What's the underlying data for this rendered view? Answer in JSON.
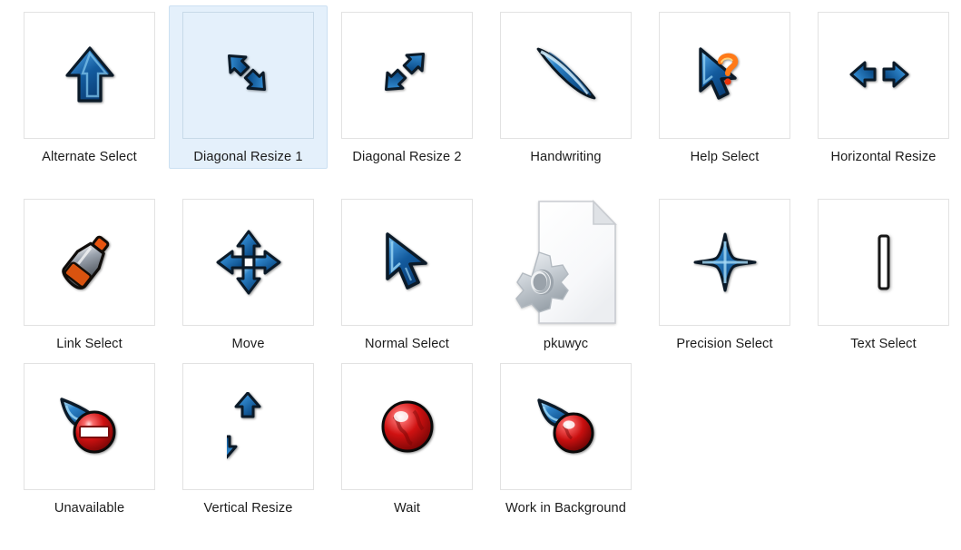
{
  "view": {
    "kind": "file-explorer-icon-grid",
    "columns": 6,
    "rows": 3,
    "background": "#ffffff",
    "selection_background": "#e4f0fb",
    "selection_border": "#cce0f2",
    "thumb_border": "#e2e2e2",
    "label_color": "#1b1b1b"
  },
  "items": [
    {
      "label": "Alternate Select",
      "icon": "cursor-arrow-up",
      "selected": false,
      "framed": true,
      "row": 1,
      "col": 1
    },
    {
      "label": "Diagonal Resize 1",
      "icon": "cursor-resize-diagonal-1",
      "selected": true,
      "framed": true,
      "row": 1,
      "col": 2
    },
    {
      "label": "Diagonal Resize 2",
      "icon": "cursor-resize-diagonal-2",
      "selected": false,
      "framed": true,
      "row": 1,
      "col": 3
    },
    {
      "label": "Handwriting",
      "icon": "cursor-handwriting-pen",
      "selected": false,
      "framed": true,
      "row": 1,
      "col": 4
    },
    {
      "label": "Help Select",
      "icon": "cursor-help-question",
      "selected": false,
      "framed": true,
      "row": 1,
      "col": 5
    },
    {
      "label": "Horizontal Resize",
      "icon": "cursor-resize-horizontal",
      "selected": false,
      "framed": true,
      "row": 1,
      "col": 6
    },
    {
      "label": "Link Select",
      "icon": "cursor-link-hand",
      "selected": false,
      "framed": true,
      "row": 2,
      "col": 1
    },
    {
      "label": "Move",
      "icon": "cursor-move-four-arrows",
      "selected": false,
      "framed": true,
      "row": 2,
      "col": 2
    },
    {
      "label": "Normal Select",
      "icon": "cursor-normal-arrow",
      "selected": false,
      "framed": true,
      "row": 2,
      "col": 3
    },
    {
      "label": "pkuwyc",
      "icon": "generic-file-gear-icon",
      "selected": false,
      "framed": false,
      "row": 2,
      "col": 4
    },
    {
      "label": "Precision Select",
      "icon": "cursor-precision-crosshair",
      "selected": false,
      "framed": true,
      "row": 2,
      "col": 5
    },
    {
      "label": "Text Select",
      "icon": "cursor-text-ibeam",
      "selected": false,
      "framed": true,
      "row": 2,
      "col": 6
    },
    {
      "label": "Unavailable",
      "icon": "cursor-unavailable-noentry",
      "selected": false,
      "framed": true,
      "row": 3,
      "col": 1
    },
    {
      "label": "Vertical Resize",
      "icon": "cursor-resize-vertical",
      "selected": false,
      "framed": true,
      "row": 3,
      "col": 2
    },
    {
      "label": "Wait",
      "icon": "cursor-wait-busy-ball",
      "selected": false,
      "framed": true,
      "row": 3,
      "col": 3
    },
    {
      "label": "Work in Background",
      "icon": "cursor-work-background",
      "selected": false,
      "framed": true,
      "row": 3,
      "col": 4
    }
  ]
}
